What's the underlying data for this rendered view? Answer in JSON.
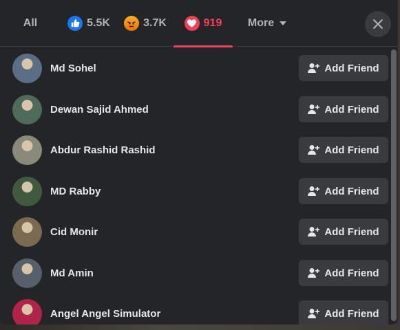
{
  "tabs": {
    "all_label": "All",
    "like_count": "5.5K",
    "angry_count": "3.7K",
    "love_count": "919",
    "more_label": "More"
  },
  "colors": {
    "accent": "#f3425f",
    "like": "#1877f2",
    "button_bg": "#3a3b3c",
    "dialog_bg": "#242526"
  },
  "people": [
    {
      "name": "Md Sohel",
      "action": "Add Friend",
      "avatar": "#5a6f86"
    },
    {
      "name": "Dewan Sajid Ahmed",
      "action": "Add Friend",
      "avatar": "#4d6a5a"
    },
    {
      "name": "Abdur Rashid Rashid",
      "action": "Add Friend",
      "avatar": "#8a8a7a"
    },
    {
      "name": "MD Rabby",
      "action": "Add Friend",
      "avatar": "#3f5a3f"
    },
    {
      "name": "Cid Monir",
      "action": "Add Friend",
      "avatar": "#7a6a50"
    },
    {
      "name": "Md Amin",
      "action": "Add Friend",
      "avatar": "#55606a"
    },
    {
      "name": "Angel Angel Simulator",
      "action": "Add Friend",
      "avatar": "#b0244a"
    }
  ]
}
